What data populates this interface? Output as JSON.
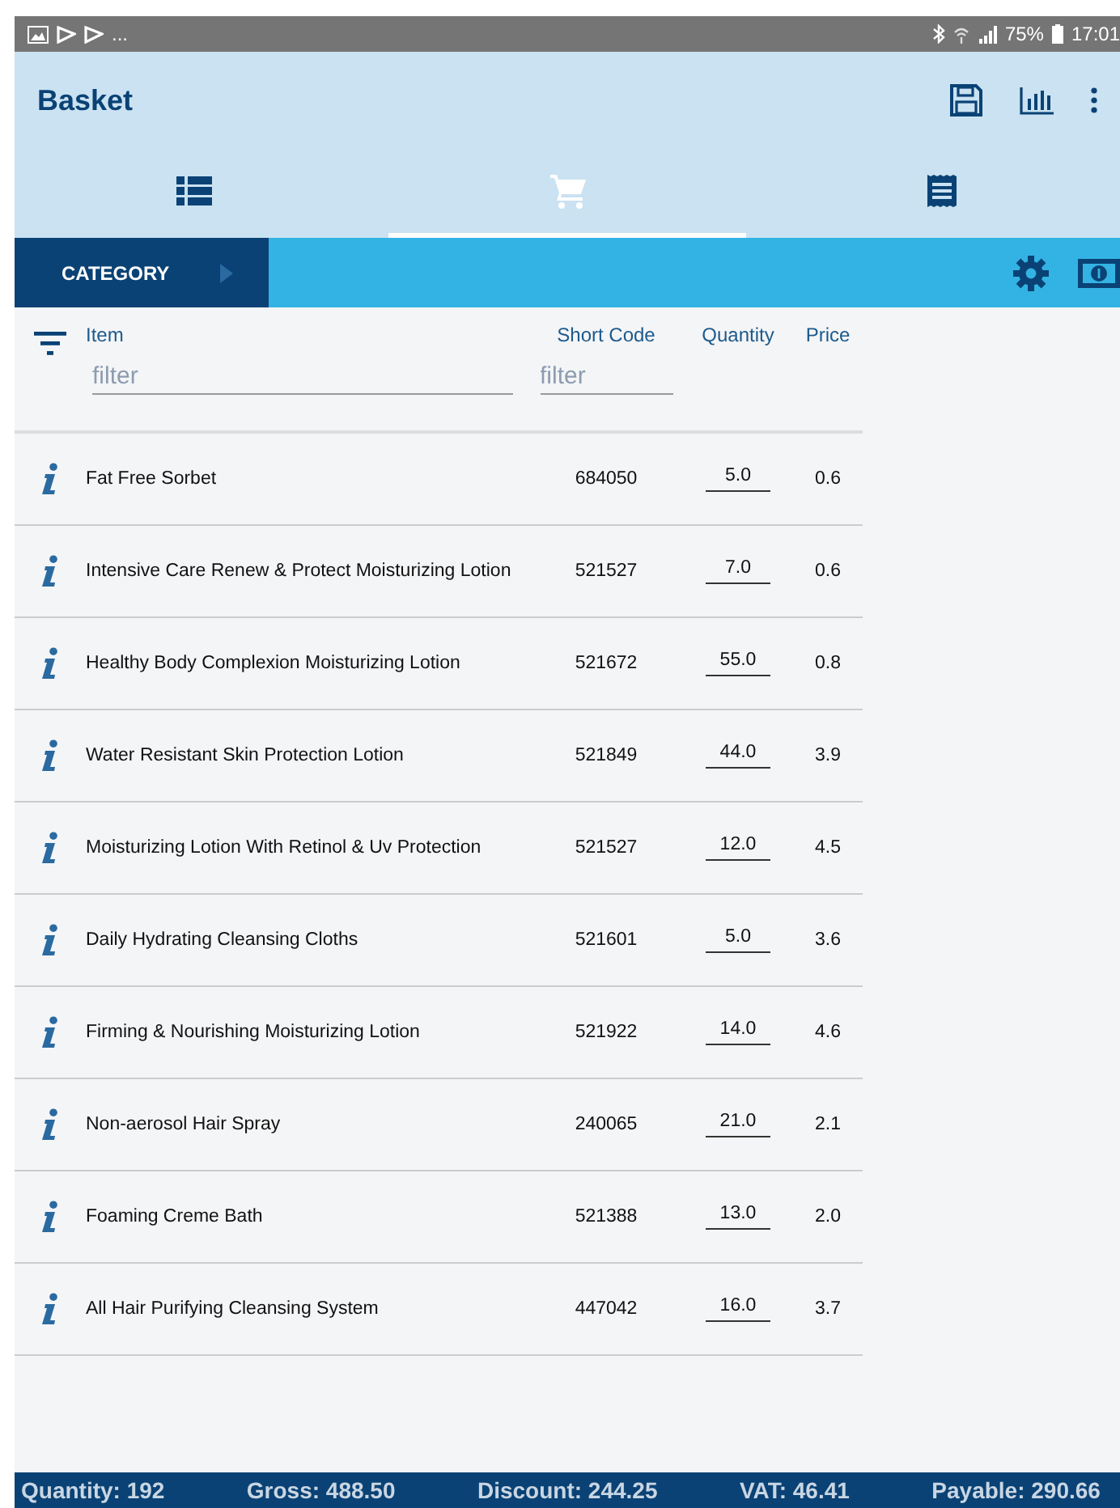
{
  "status_bar": {
    "more": "...",
    "battery": "75%",
    "time": "17:01"
  },
  "app_bar": {
    "title": "Basket"
  },
  "tabs": [
    {
      "kind": "list",
      "selected": false
    },
    {
      "kind": "cart",
      "selected": true
    },
    {
      "kind": "receipt",
      "selected": false
    }
  ],
  "category": {
    "label": "CATEGORY"
  },
  "table": {
    "columns": [
      "Item",
      "Short Code",
      "Quantity",
      "Price"
    ],
    "filters": [
      {
        "placeholder": "filter"
      },
      {
        "placeholder": "filter"
      }
    ],
    "rows": [
      {
        "item": "Fat Free Sorbet",
        "code": "684050",
        "quantity": "5.0",
        "price": "0.6"
      },
      {
        "item": "Intensive Care Renew & Protect Moisturizing Lotion",
        "code": "521527",
        "quantity": "7.0",
        "price": "0.6"
      },
      {
        "item": "Healthy Body Complexion Moisturizing Lotion",
        "code": "521672",
        "quantity": "55.0",
        "price": "0.8"
      },
      {
        "item": "Water Resistant Skin Protection Lotion",
        "code": "521849",
        "quantity": "44.0",
        "price": "3.9"
      },
      {
        "item": "Moisturizing Lotion With Retinol & Uv Protection",
        "code": "521527",
        "quantity": "12.0",
        "price": "4.5"
      },
      {
        "item": "Daily Hydrating Cleansing Cloths",
        "code": "521601",
        "quantity": "5.0",
        "price": "3.6"
      },
      {
        "item": "Firming & Nourishing Moisturizing Lotion",
        "code": "521922",
        "quantity": "14.0",
        "price": "4.6"
      },
      {
        "item": "Non-aerosol Hair Spray",
        "code": "240065",
        "quantity": "21.0",
        "price": "2.1"
      },
      {
        "item": "Foaming Creme Bath",
        "code": "521388",
        "quantity": "13.0",
        "price": "2.0"
      },
      {
        "item": "All Hair Purifying Cleansing System",
        "code": "447042",
        "quantity": "16.0",
        "price": "3.7"
      }
    ]
  },
  "totals": [
    "Quantity: 192",
    "Gross: 488.50",
    "Discount: 244.25",
    "VAT: 46.41",
    "Payable: 290.66"
  ]
}
